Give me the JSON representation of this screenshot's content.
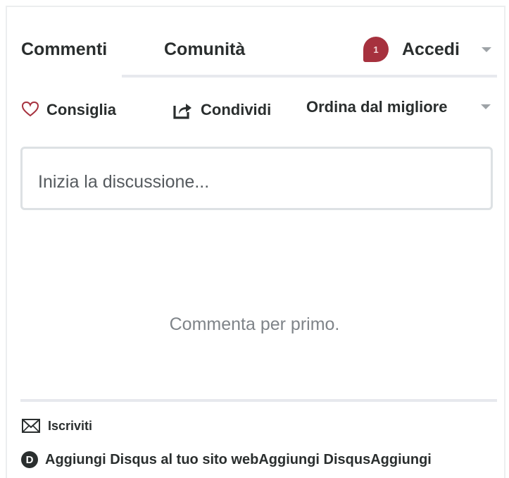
{
  "tabs": {
    "comments": "Commenti",
    "community": "Comunità"
  },
  "header": {
    "notification_count": "1",
    "login_label": "Accedi"
  },
  "actions": {
    "recommend": "Consiglia",
    "share": "Condividi",
    "sort": "Ordina dal migliore"
  },
  "composer": {
    "placeholder": "Inizia la discussione..."
  },
  "empty_state": "Commenta per primo.",
  "footer": {
    "subscribe": "Iscriviti",
    "add_disqus": "Aggiungi Disqus al tuo sito webAggiungi DisqusAggiungi"
  },
  "colors": {
    "badge": "#a6313e",
    "heart": "#a6313e",
    "text": "#2a2e2e",
    "muted": "#7f8489",
    "border": "#dde1e4"
  },
  "icons": {
    "recommend": "heart-icon",
    "share": "share-icon",
    "subscribe": "envelope-icon",
    "brand": "disqus-logo-icon"
  }
}
